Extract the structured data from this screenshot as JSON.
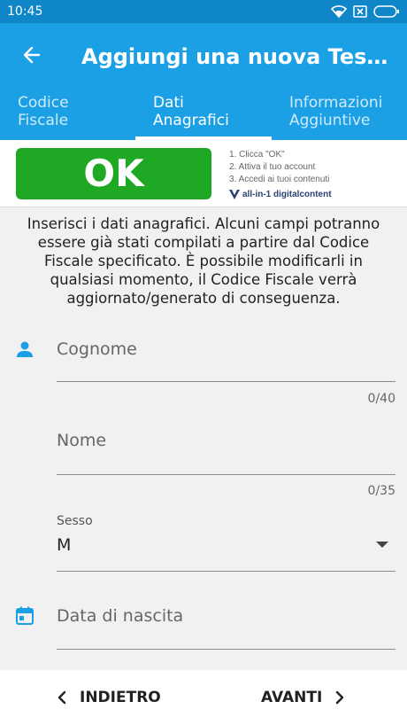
{
  "status_bar": {
    "time": "10:45"
  },
  "header": {
    "title": "Aggiungi una nuova Tessera ..."
  },
  "tabs": [
    {
      "label": "Codice\nFiscale",
      "active": false
    },
    {
      "label": "Dati\nAnagrafici",
      "active": true
    },
    {
      "label": "Informazioni\nAggiuntive",
      "active": false
    }
  ],
  "ad": {
    "button_text": "OK",
    "steps": [
      "1. Clicca \"OK\"",
      "2. Attiva il tuo account",
      "3. Accedi ai tuoi contenuti"
    ],
    "brand": "all-in-1 digitalcontent"
  },
  "intro_text": "Inserisci i dati anagrafici. Alcuni campi potranno essere già stati compilati a partire dal Codice Fiscale specificato. È possibile modificarli in qualsiasi momento, il Codice Fiscale verrà aggiornato/generato di conseguenza.",
  "form": {
    "cognome": {
      "placeholder": "Cognome",
      "counter": "0/40"
    },
    "nome": {
      "placeholder": "Nome",
      "counter": "0/35"
    },
    "sesso": {
      "label": "Sesso",
      "value": "M"
    },
    "data_nascita": {
      "placeholder": "Data di nascita"
    }
  },
  "footer": {
    "back_label": "INDIETRO",
    "next_label": "AVANTI"
  },
  "colors": {
    "primary": "#1ba0e5",
    "status_bar": "#0f86c8",
    "ok_green": "#1fa824"
  },
  "icons": [
    "wifi-icon",
    "sim-x-icon",
    "battery-icon",
    "arrow-back-icon",
    "person-icon",
    "calendar-icon",
    "chevron-left-icon",
    "chevron-right-icon",
    "dropdown-arrow-icon"
  ]
}
